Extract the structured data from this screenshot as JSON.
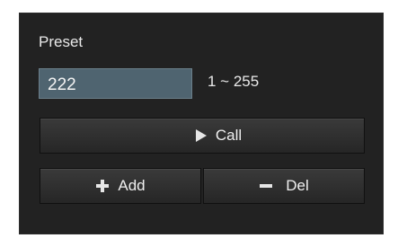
{
  "preset": {
    "title": "Preset",
    "value": "222",
    "range": "1 ~ 255"
  },
  "buttons": {
    "call_label": "Call",
    "add_label": "Add",
    "del_label": "Del"
  },
  "icons": {
    "call": "play-icon",
    "add": "plus-icon",
    "del": "minus-icon"
  },
  "colors": {
    "panel_bg": "#222222",
    "input_bg": "#4f6470",
    "text": "#e9e9e9"
  }
}
